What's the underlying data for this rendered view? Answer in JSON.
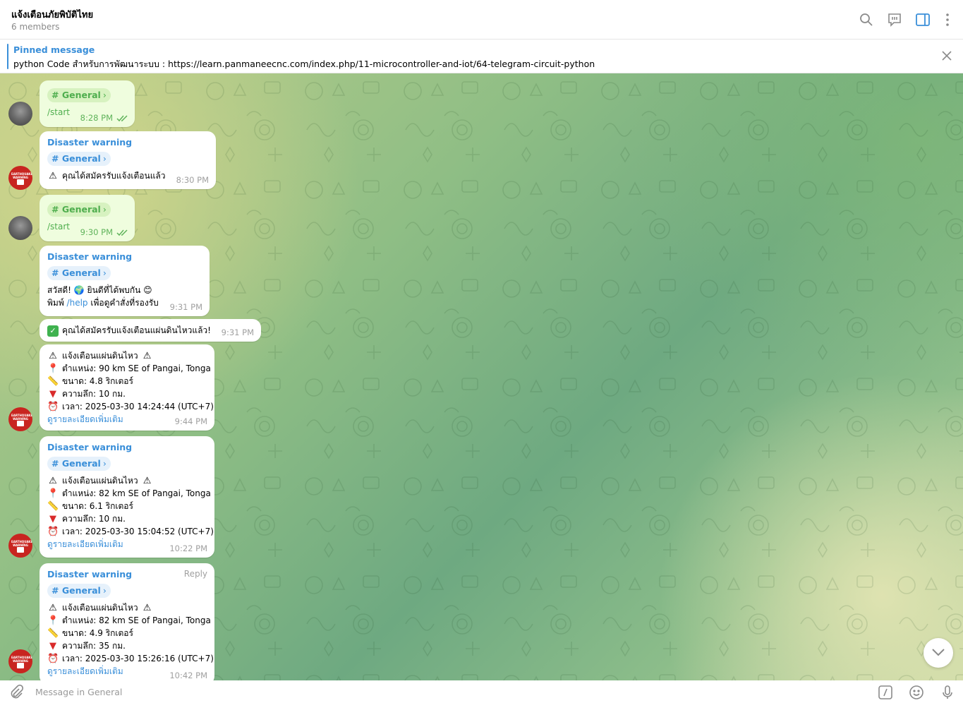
{
  "header": {
    "title": "แจ้งเตือนภัยพิบัติไทย",
    "subtitle": "6 members",
    "icons": [
      "search-icon",
      "topics-icon",
      "sidebar-toggle-icon",
      "more-icon"
    ]
  },
  "pinned": {
    "title": "Pinned message",
    "text": "python Code สำหรับการพัฒนาระบบ : https://learn.panmaneecnc.com/index.php/11-microcontroller-and-iot/64-telegram-circuit-python"
  },
  "colors": {
    "accent": "#3a8fd9",
    "outgoing_bubble": "#effdde",
    "outgoing_accent": "#4fae4e",
    "incoming_bubble": "#ffffff"
  },
  "messages": [
    {
      "id": "m1",
      "direction": "out",
      "topic": "# General",
      "text": "/start",
      "time": "8:28 PM"
    },
    {
      "id": "m2",
      "direction": "in",
      "sender": "Disaster warning",
      "topic": "# General",
      "text": "คุณได้สมัครรับแจ้งเตือนแล้ว",
      "time": "8:30 PM"
    },
    {
      "id": "m3",
      "direction": "out",
      "topic": "# General",
      "text": "/start",
      "time": "9:30 PM"
    },
    {
      "id": "m4",
      "direction": "in",
      "sender": "Disaster warning",
      "topic": "# General",
      "line1": "สวัสดี! 🌍 ยินดีที่ได้พบกัน 😊",
      "line2_pre": "พิมพ์ ",
      "line2_cmd": "/help",
      "line2_post": " เพื่อดูคำสั่งที่รองรับ",
      "time": "9:31 PM"
    },
    {
      "id": "m5",
      "direction": "in",
      "text": "คุณได้สมัครรับแจ้งเตือนแผ่นดินไหวแล้ว!",
      "time": "9:31 PM"
    },
    {
      "id": "m6",
      "direction": "in",
      "heading": "แจ้งเตือนแผ่นดินไหว",
      "location": "ตำแหน่ง: 90 km SE of Pangai, Tonga",
      "magnitude": "ขนาด: 4.8 ริกเตอร์",
      "depth": "ความลึก: 10 กม.",
      "datetime": "เวลา: 2025-03-30 14:24:44 (UTC+7)",
      "link": "ดูรายละเอียดเพิ่มเติม",
      "time": "9:44 PM"
    },
    {
      "id": "m7",
      "direction": "in",
      "sender": "Disaster warning",
      "topic": "# General",
      "heading": "แจ้งเตือนแผ่นดินไหว",
      "location": "ตำแหน่ง: 82 km SE of Pangai, Tonga",
      "magnitude": "ขนาด: 6.1 ริกเตอร์",
      "depth": "ความลึก: 10 กม.",
      "datetime": "เวลา: 2025-03-30 15:04:52 (UTC+7)",
      "link": "ดูรายละเอียดเพิ่มเติม",
      "time": "10:22 PM"
    },
    {
      "id": "m8",
      "direction": "in",
      "sender": "Disaster warning",
      "topic": "# General",
      "reply_label": "Reply",
      "heading": "แจ้งเตือนแผ่นดินไหว",
      "location": "ตำแหน่ง: 82 km SE of Pangai, Tonga",
      "magnitude": "ขนาด: 4.9 ริกเตอร์",
      "depth": "ความลึก: 35 กม.",
      "datetime": "เวลา: 2025-03-30 15:26:16 (UTC+7)",
      "link": "ดูรายละเอียดเพิ่มเติม",
      "time": "10:42 PM"
    }
  ],
  "bot_avatar": {
    "text": "EARTHQUAKE WARNING"
  },
  "composer": {
    "placeholder": "Message in General",
    "icons": [
      "attach-icon",
      "commands-icon",
      "emoji-icon",
      "microphone-icon"
    ]
  }
}
